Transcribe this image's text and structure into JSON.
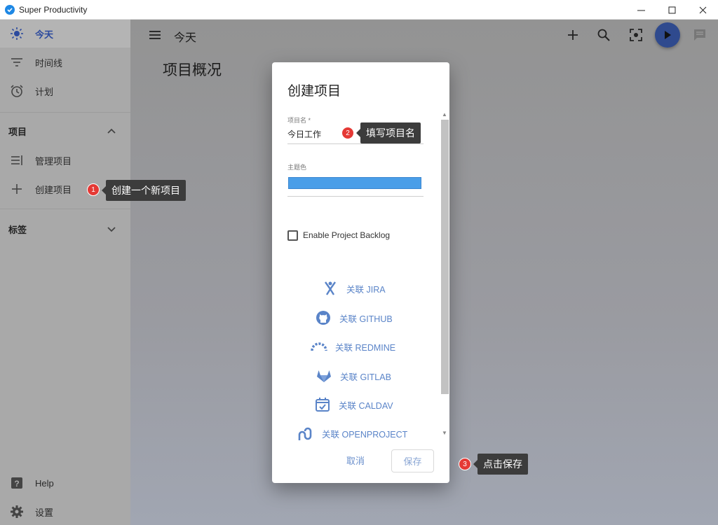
{
  "window": {
    "title": "Super Productivity"
  },
  "sidebar": {
    "items": [
      {
        "label": "今天",
        "icon": "sun-icon"
      },
      {
        "label": "时间线",
        "icon": "filter-lines-icon"
      },
      {
        "label": "计划",
        "icon": "alarm-icon"
      }
    ],
    "projects_section": "项目",
    "project_items": [
      {
        "label": "管理项目",
        "icon": "list-settings-icon"
      },
      {
        "label": "创建项目",
        "icon": "plus-icon"
      }
    ],
    "tags_section": "标签",
    "footer_items": [
      {
        "label": "Help",
        "icon": "help-icon"
      },
      {
        "label": "设置",
        "icon": "gear-icon"
      }
    ]
  },
  "header": {
    "title": "今天",
    "page_heading": "项目概况"
  },
  "dialog": {
    "title": "创建项目",
    "project_name_label": "项目名 *",
    "project_name_value": "今日工作",
    "theme_color_label": "主题色",
    "theme_color": "#4a9ee8",
    "backlog_label": "Enable Project Backlog",
    "integrations": [
      {
        "label": "关联 JIRA",
        "icon": "jira-icon"
      },
      {
        "label": "关联 GITHUB",
        "icon": "github-icon"
      },
      {
        "label": "关联 REDMINE",
        "icon": "redmine-icon"
      },
      {
        "label": "关联 GITLAB",
        "icon": "gitlab-icon"
      },
      {
        "label": "关联 CALDAV",
        "icon": "calendar-check-icon"
      },
      {
        "label": "关联 OPENPROJECT",
        "icon": "openproject-icon"
      }
    ],
    "cancel_label": "取消",
    "save_label": "保存"
  },
  "annotations": [
    {
      "number": "1",
      "text": "创建一个新项目"
    },
    {
      "number": "2",
      "text": "填写项目名"
    },
    {
      "number": "3",
      "text": "点击保存"
    }
  ],
  "colors": {
    "accent": "#2f4a8e",
    "link": "#5a84c8",
    "badge": "#e53935"
  }
}
